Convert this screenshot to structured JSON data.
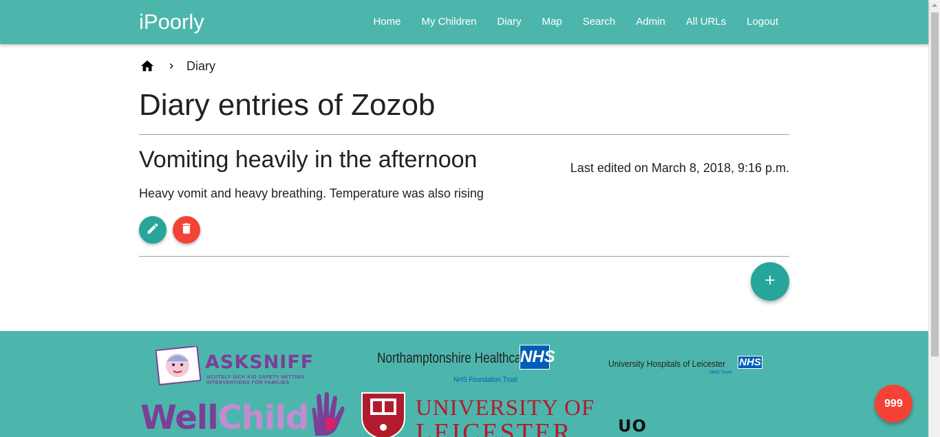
{
  "navbar": {
    "brand": "iPoorly",
    "links": [
      "Home",
      "My Children",
      "Diary",
      "Map",
      "Search",
      "Admin",
      "All URLs",
      "Logout"
    ]
  },
  "breadcrumb": {
    "icon": "home-icon",
    "separator_icon": "chevron-right-icon",
    "current": "Diary"
  },
  "page": {
    "title": "Diary entries of Zozob"
  },
  "entries": [
    {
      "title": "Vomiting heavily in the afternoon",
      "meta": "Last edited on March 8, 2018, 9:16 p.m.",
      "body": "Heavy vomit and heavy breathing. Temperature was also rising",
      "edit_icon": "pencil-icon",
      "delete_icon": "trash-icon"
    }
  ],
  "actions": {
    "add_icon": "plus-icon",
    "emergency_label": "999"
  },
  "footer": {
    "asksniff": {
      "word_ask": "ASK",
      "word_sniff": "SNIFF",
      "sub_line1": "ACUTELY SICK KID SAFETY NETTING",
      "sub_line2": "INTERVENTIONS FOR FAMILIES"
    },
    "northants": {
      "name": "Northamptonshire Healthcare",
      "badge": "NHS",
      "sub": "NHS Foundation Trust"
    },
    "uhl": {
      "name": "University Hospitals of Leicester",
      "badge": "NHS",
      "sub": "NHS Trust"
    },
    "wellchild": {
      "word_well": "Well",
      "word_child": "Child"
    },
    "uol": {
      "line1": "UNIVERSITY OF",
      "line2": "LEICESTER"
    },
    "uo": {
      "word": "UO"
    }
  },
  "colors": {
    "primary": "#4db6ac",
    "accent": "#26a69a",
    "danger": "#f44336",
    "nhs_blue": "#005eb8",
    "purple": "#7b3f98",
    "uol_red": "#b01c2e"
  }
}
